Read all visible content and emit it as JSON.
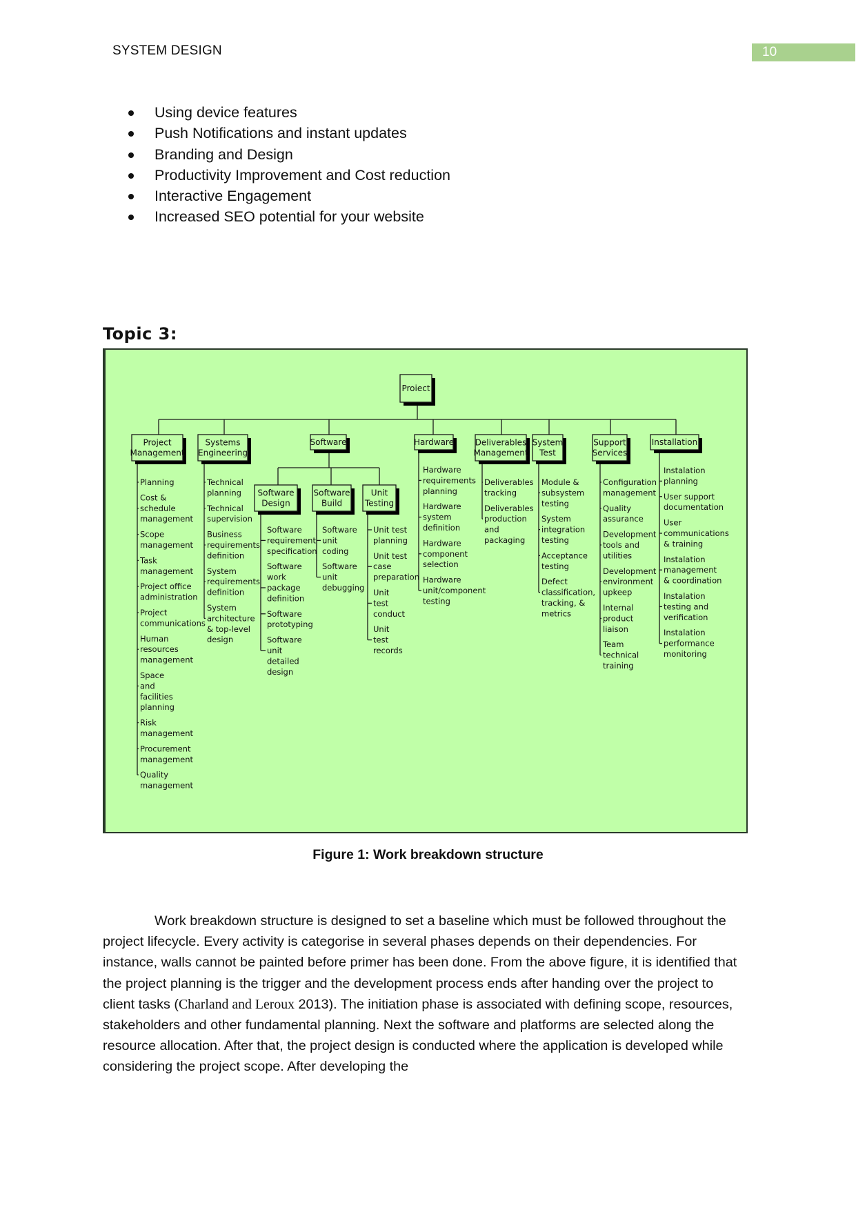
{
  "header": {
    "title": "SYSTEM DESIGN",
    "page_number": "10"
  },
  "bullets": [
    "Using device features",
    "Push Notifications and instant updates",
    "Branding and Design",
    "Productivity Improvement and Cost reduction",
    "Interactive Engagement",
    "Increased SEO potential for your website"
  ],
  "topic_heading": "Topic 3:",
  "figure": {
    "caption": "Figure 1: Work breakdown structure",
    "root": "Proiect",
    "branches": [
      {
        "label": [
          "Project",
          "Management"
        ],
        "items": [
          [
            "Planning"
          ],
          [
            "Cost &",
            "schedule",
            "management"
          ],
          [
            "Scope",
            "management"
          ],
          [
            "Task",
            "management"
          ],
          [
            "Project office",
            "administration"
          ],
          [
            "Project",
            "communications"
          ],
          [
            "Human",
            "resources",
            "management"
          ],
          [
            "Space",
            "and",
            "facilities",
            "planning"
          ],
          [
            "Risk",
            "management"
          ],
          [
            "Procurement",
            "management"
          ],
          [
            "Quality",
            "management"
          ]
        ]
      },
      {
        "label": [
          "Systems",
          "Engineering"
        ],
        "items": [
          [
            "Technical",
            "planning"
          ],
          [
            "Technical",
            "supervision"
          ],
          [
            "Business",
            "requirements",
            "definition"
          ],
          [
            "System",
            "requirements",
            "definition"
          ],
          [
            "System",
            "architecture",
            "& top-level",
            "design"
          ]
        ]
      },
      {
        "label": [
          "Software"
        ],
        "children": [
          {
            "label": [
              "Software",
              "Design"
            ],
            "items": [
              [
                "Software",
                "requirement",
                "specification"
              ],
              [
                "Software",
                "work",
                "package",
                "definition"
              ],
              [
                "Software",
                "prototyping"
              ],
              [
                "Software",
                "unit",
                "detailed",
                "design"
              ]
            ]
          },
          {
            "label": [
              "Software",
              "Build"
            ],
            "items": [
              [
                "Software",
                "unit",
                "coding"
              ],
              [
                "Software",
                "unit",
                "debugging"
              ]
            ]
          },
          {
            "label": [
              "Unit",
              "Testing"
            ],
            "items": [
              [
                "Unit test",
                "planning"
              ],
              [
                "Unit test",
                "case",
                "preparation"
              ],
              [
                "Unit",
                "test",
                "conduct"
              ],
              [
                "Unit",
                "test",
                "records"
              ]
            ]
          }
        ]
      },
      {
        "label": [
          "Hardware"
        ],
        "items": [
          [
            "Hardware",
            "requirements",
            "planning"
          ],
          [
            "Hardware",
            "system",
            "definition"
          ],
          [
            "Hardware",
            "component",
            "selection"
          ],
          [
            "Hardware",
            "unit/component",
            "testing"
          ]
        ]
      },
      {
        "label": [
          "Deliverables",
          "Management"
        ],
        "items": [
          [
            "Deliverables",
            "tracking"
          ],
          [
            "Deliverables",
            "production",
            "and",
            "packaging"
          ]
        ]
      },
      {
        "label": [
          "System",
          "Test"
        ],
        "items": [
          [
            "Module &",
            "subsystem",
            "testing"
          ],
          [
            "System",
            "integration",
            "testing"
          ],
          [
            "Acceptance",
            "testing"
          ],
          [
            "Defect",
            "classification,",
            "tracking, &",
            "metrics"
          ]
        ]
      },
      {
        "label": [
          "Support",
          "Services"
        ],
        "items": [
          [
            "Configuration",
            "management"
          ],
          [
            "Quality",
            "assurance"
          ],
          [
            "Development",
            "tools and",
            "utilities"
          ],
          [
            "Development",
            "environment",
            "upkeep"
          ],
          [
            "Internal",
            "product",
            "liaison"
          ],
          [
            "Team",
            "technical",
            "training"
          ]
        ]
      },
      {
        "label": [
          "Installation"
        ],
        "items": [
          [
            "Instalation",
            "planning"
          ],
          [
            "User support",
            "documentation"
          ],
          [
            "User",
            "communications",
            "& training"
          ],
          [
            "Instalation",
            "management",
            "& coordination"
          ],
          [
            "Instalation",
            "testing and",
            "verification"
          ],
          [
            "Instalation",
            "performance",
            "monitoring"
          ]
        ]
      }
    ]
  },
  "paragraph": {
    "part1": "Work breakdown structure is designed to set a baseline which must be followed throughout the project lifecycle. Every activity is categorise in several phases depends on their dependencies. For instance, walls cannot be painted before primer has been done. From the above figure, it is identified that the project planning is the trigger and the development process ends after handing over the project to client tasks (",
    "citation": "Charland and Leroux",
    "part2": " 2013). The initiation phase is associated with defining scope, resources, stakeholders and other fundamental planning. Next the software and platforms are selected along the resource allocation. After that, the project design is conducted where the application is developed while considering the project scope. After developing the"
  }
}
